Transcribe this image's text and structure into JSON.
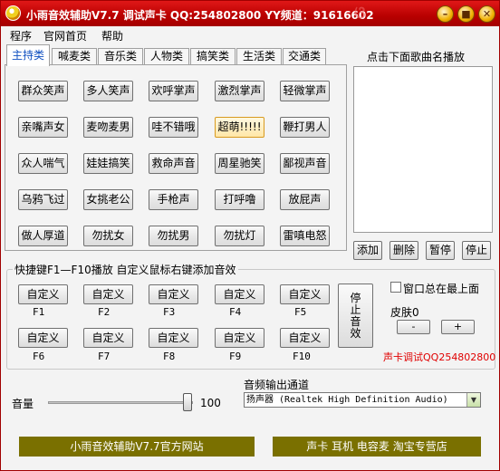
{
  "window": {
    "title": "小雨音效辅助V7.7 调试声卡 QQ:254802800  YY频道：91616602",
    "controls": {
      "minimize": "–",
      "maximize": "■",
      "close": "✕"
    }
  },
  "menu": [
    "程序",
    "官网首页",
    "帮助"
  ],
  "tabs": [
    "主持类",
    "喊麦类",
    "音乐类",
    "人物类",
    "搞笑类",
    "生活类",
    "交通类"
  ],
  "sound_buttons": [
    [
      "群众笑声",
      "多人笑声",
      "欢呼掌声",
      "激烈掌声",
      "轻微掌声"
    ],
    [
      "亲嘴声女",
      "麦吻麦男",
      "哇不错哦",
      "超萌!!!!!",
      "鞭打男人"
    ],
    [
      "众人喘气",
      "娃娃搞笑",
      "救命声音",
      "周星驰笑",
      "鄙视声音"
    ],
    [
      "乌鸦飞过",
      "女挑老公",
      "手枪声",
      "打呼噜",
      "放屁声"
    ],
    [
      "做人厚道",
      "勿扰女",
      "勿扰男",
      "勿扰灯",
      "雷嗔电怒"
    ]
  ],
  "playlist": {
    "title": "点击下面歌曲名播放",
    "buttons": [
      "添加",
      "删除",
      "暂停",
      "停止"
    ]
  },
  "shortcuts": {
    "group_label": "快捷键F1—F10播放   自定义鼠标右键添加音效",
    "custom_label": "自定义",
    "keys": [
      "F1",
      "F2",
      "F3",
      "F4",
      "F5",
      "F6",
      "F7",
      "F8",
      "F9",
      "F10"
    ],
    "stop_label": "停止音效",
    "always_on_top_label": "窗口总在最上面",
    "always_on_top_checked": false,
    "skin_label": "皮肤0",
    "skin_minus": "-",
    "skin_plus": "+",
    "red_note": "声卡调试QQ254802800"
  },
  "volume": {
    "label": "音量",
    "value": "100",
    "level": 1.0
  },
  "audio_output": {
    "label": "音频输出通道",
    "selected": "扬声器 (Realtek High Definition Audio)"
  },
  "banners": {
    "left": "小雨音效辅助V7.7官方网站",
    "right": "声卡 耳机 电容麦 淘宝专营店"
  },
  "colors": {
    "title_red": "#c00000",
    "banner_olive": "#7a7000",
    "note_red": "#e00000",
    "active_tab_text": "#1050c0"
  }
}
